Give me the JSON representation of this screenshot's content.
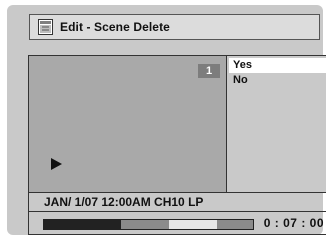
{
  "header": {
    "title": "Edit - Scene Delete",
    "icon": "edit-folder-icon"
  },
  "preview": {
    "scene_number": "1",
    "play_icon": "play-icon"
  },
  "menu": {
    "items": [
      {
        "label": "Yes",
        "selected": true
      },
      {
        "label": "No",
        "selected": false
      }
    ]
  },
  "status": {
    "info": "JAN/ 1/07 12:00AM CH10   LP"
  },
  "timeline": {
    "time": "0 : 07 : 00",
    "played_fraction": 0.37,
    "light_start_fraction": 0.6,
    "light_end_fraction": 0.83
  },
  "colors": {
    "screen_bg": "#c9c9c9",
    "preview_bg": "#a9a9a9",
    "selected_bg": "#ffffff",
    "played": "#222222",
    "track": "#8b8b8b"
  }
}
